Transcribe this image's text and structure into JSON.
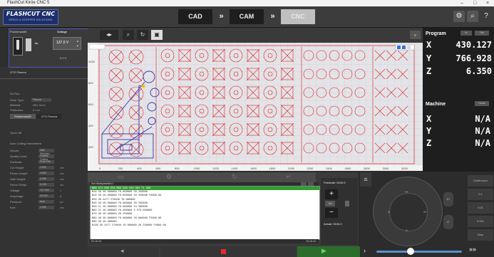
{
  "window": {
    "title": "FlashCut Kiröe CNC 5",
    "controls": [
      "–",
      "□",
      "×"
    ]
  },
  "logo": {
    "name": "FLASHCUT CNC",
    "tagline": "SERVO & STEPPER SOLUTIONS"
  },
  "modes": {
    "cad": "CAD",
    "cam": "CAM",
    "cnc": "CNC",
    "arrow": "»"
  },
  "toolbar_icons": [
    "settings-icon",
    "zoom-icon",
    "help-icon"
  ],
  "left": {
    "powermax_label": "Powermax65",
    "voltage_label": "Voltage",
    "voltage_value": "137.0 V",
    "voltage_sub": "0.0 V",
    "thc_label": "GTS Plasma",
    "header1": "No Run",
    "rows": [
      {
        "label": "Work Type:",
        "value": "Plasma"
      },
      {
        "label": "Material:",
        "value": "Mild Steel"
      },
      {
        "label": "Thickness:",
        "value": "8 mm"
      }
    ],
    "buttons": [
      "Powermax65",
      "GTS Plasma"
    ],
    "header2": "Torch Off",
    "header3": "Auto Cutting Parameters",
    "params": [
      {
        "label": "Nozzle:",
        "value": "Mild Shielded"
      },
      {
        "label": "Quality Level:",
        "value": "Fastest Cutting"
      },
      {
        "label": "Feedrate:",
        "value": "From File"
      },
      {
        "label": "Cut Height:",
        "value": "1.500",
        "unit": "mm"
      },
      {
        "label": "Pierce Height:",
        "value": "3.800",
        "unit": "mm"
      },
      {
        "label": "Safe Height:",
        "value": "6.350",
        "unit": "mm"
      },
      {
        "label": "Pierce Delay:",
        "value": "0.100",
        "unit": "sec"
      },
      {
        "label": "Voltage:",
        "value": "127.000",
        "unit": "V"
      },
      {
        "label": "Amperage:",
        "value": "45.000",
        "unit": "A"
      },
      {
        "label": "Pressure:",
        "value": "Auto",
        "unit": "psi"
      },
      {
        "label": "Kerf:",
        "value": "1.300",
        "unit": "mm"
      }
    ]
  },
  "canvas": {
    "y_ticks": [
      "1000",
      "800",
      "600",
      "400",
      "200"
    ],
    "x_ticks": [
      "0",
      "200",
      "400",
      "600",
      "800",
      "1000",
      "1200",
      "1400",
      "1600",
      "1800",
      "2000",
      "2200",
      "2400",
      "2600",
      "2800",
      "3000",
      "3200"
    ]
  },
  "gcode": {
    "title": "Xml WorkpieceWo 1",
    "lines": [
      "N00  G71 G90  G94 M03 G40 G54 G64  T1 G00",
      "N10  G0 X0.000000 Y0.000000 Z6.350000",
      "N20  G0 X0.000000 Y0.000000 Z6.350000 F6000.00",
      "N30  G0 X477.378640 Y0.000000",
      "N40  G0 X0.000000 Y0.000000 Z6.350000",
      "N50  G1 X0.000000 Y0.000000 Z4.500000",
      "N60  G1 X0.000000 Y0.000000 Z-970.000000",
      "N70  G0 X0.000000 Z6.350000",
      "N80  G0 X0.000000 Y0.000000 Z0.000000 F5000.00",
      "N90  G0 X0.000000",
      "N100  G0 X477.378640 Y0.000000 Z6.350000 F5000.00"
    ],
    "status_left": "DL:00:15",
    "status_right": "00:16:43"
  },
  "feed": {
    "label": "Feedrate: 5100.0",
    "actual": "Actual:  5100.0",
    "percent": "100"
  },
  "dro": {
    "program_label": "Program",
    "program_btns": [
      "In",
      "Set"
    ],
    "axes": [
      {
        "axis": "X",
        "value": "430.127"
      },
      {
        "axis": "Y",
        "value": "766.928"
      },
      {
        "axis": "Z",
        "value": "6.350"
      }
    ],
    "machine_label": "Machine",
    "machine_btn": "Home",
    "machine_axes": [
      {
        "axis": "X",
        "value": "N/A"
      },
      {
        "axis": "Y",
        "value": "N/A"
      },
      {
        "axis": "Z",
        "value": "N/A"
      }
    ]
  },
  "jog": {
    "labels": {
      "yplus": "Y+",
      "yminus": "Y-",
      "xplus": "X+",
      "xminus": "X-",
      "zplus": "Z+",
      "zminus": "Z-"
    },
    "side_buttons": [
      "Continuous",
      "0.1",
      "0.01",
      "0.001",
      "Step"
    ],
    "speed_percent": 40
  }
}
